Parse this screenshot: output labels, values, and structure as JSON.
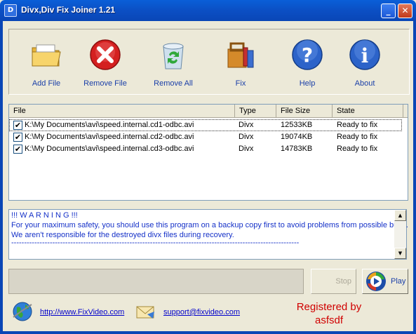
{
  "window": {
    "title": "Divx,Div Fix Joiner  1.21",
    "app_icon": "D",
    "minimize_glyph": "_",
    "close_glyph": "✕"
  },
  "toolbar": [
    {
      "label": "Add File",
      "icon": "folder-icon"
    },
    {
      "label": "Remove File",
      "icon": "red-x-icon"
    },
    {
      "label": "Remove All",
      "icon": "recycle-bin-icon"
    },
    {
      "label": "Fix",
      "icon": "toolbox-icon"
    },
    {
      "label": "Help",
      "icon": "question-icon"
    },
    {
      "label": "About",
      "icon": "info-icon"
    }
  ],
  "file_list": {
    "columns": [
      "File",
      "Type",
      "File Size",
      "State"
    ],
    "rows": [
      {
        "checked": true,
        "file": "K:\\My Documents\\avi\\speed.internal.cd1-odbc.avi",
        "type": "Divx",
        "size": "12533KB",
        "state": "Ready to fix"
      },
      {
        "checked": true,
        "file": "K:\\My Documents\\avi\\speed.internal.cd2-odbc.avi",
        "type": "Divx",
        "size": "19074KB",
        "state": "Ready to fix"
      },
      {
        "checked": true,
        "file": "K:\\My Documents\\avi\\speed.internal.cd3-odbc.avi",
        "type": "Divx",
        "size": "14783KB",
        "state": "Ready to fix"
      }
    ],
    "check_glyph": "✔"
  },
  "messages": {
    "lines": [
      "!!! W A R N I N G !!!",
      "For your maximum safety, you should use this program on a backup copy first to avoid problems from possible bugs.",
      "We aren't responsible for the destroyed divx files during recovery.",
      "----------------------------------------------------------------------------------------------------------------"
    ],
    "scroll_up": "▲",
    "scroll_down": "▼"
  },
  "controls": {
    "stop_label": "Stop",
    "play_label": "Play"
  },
  "footer": {
    "website": "http://www.FixVideo.com",
    "email": "support@fixvideo.com",
    "registered_line1": "Registered by",
    "registered_line2": "asfsdf"
  },
  "colors": {
    "titlebar": "#0A4FC4",
    "link": "#1a3fa8",
    "warning_text": "#1531c8",
    "registered": "#d00000"
  }
}
